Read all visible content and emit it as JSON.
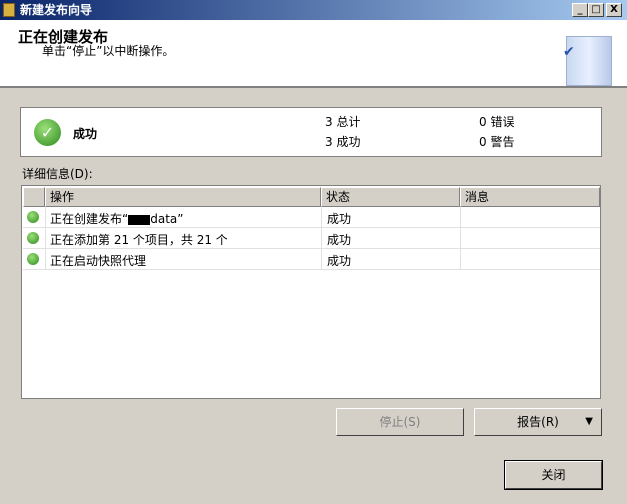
{
  "window": {
    "title": "新建发布向导",
    "min": "_",
    "max": "□",
    "close": "X"
  },
  "header": {
    "title": "正在创建发布",
    "subtitle": "单击“停止”以中断操作。"
  },
  "summary": {
    "status": "成功",
    "total": "3 总计",
    "success": "3 成功",
    "errors": "0 错误",
    "warnings": "0 警告"
  },
  "details": {
    "label": "详细信息(D):",
    "columns": [
      "操作",
      "状态",
      "消息"
    ],
    "rows": [
      {
        "action_prefix": "正在创建发布“",
        "action_suffix": "data”",
        "status": "成功",
        "message": ""
      },
      {
        "action": "正在添加第 21 个项目，共 21 个",
        "status": "成功",
        "message": ""
      },
      {
        "action": "正在启动快照代理",
        "status": "成功",
        "message": ""
      }
    ]
  },
  "buttons": {
    "stop": "停止(S)",
    "report": "报告(R)",
    "report_arrow": "▼",
    "close": "关闭"
  }
}
